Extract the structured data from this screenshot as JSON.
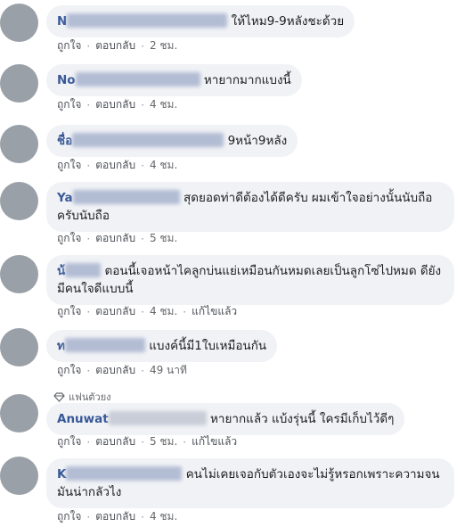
{
  "comments": [
    {
      "name": "N",
      "text": "ให้ไหม9-9หลังชะด้วย",
      "time": "2 ชม.",
      "edited": ""
    },
    {
      "name": "No",
      "text": "หายากมากแบงนี้",
      "time": "4 ชม.",
      "edited": ""
    },
    {
      "name": "ชื่อ",
      "text": "9หน้า9หลัง",
      "time": "4 ชม.",
      "edited": ""
    },
    {
      "name": "Ya",
      "text": "สุดยอดท่าดีต้องได้ดีครับ ผมเข้าใจอย่างนั้นนับถือครับนับถือ",
      "time": "5 ชม.",
      "edited": ""
    },
    {
      "name": "น้",
      "text": "ตอนนี้เจอหน้าไคลูกบ่นแย่เหมือนกันหมดเลยเป็นลูกโซ่ไปหมด ดียังมีคนใจดีแบบนี้",
      "time": "4 ชม.",
      "edited": "แก้ไขแล้ว"
    },
    {
      "name": "ท",
      "text": "แบงค์นี้มี1ใบเหมือนกัน",
      "time": "49 นาที",
      "edited": ""
    },
    {
      "name": "Anuwat",
      "text": "หายากแล้ว แบ้งรุ่นนี้ ใครมีเก็บไว้ดีๆ",
      "time": "5 ชม.",
      "edited": "แก้ไขแล้ว",
      "badge": "แฟนตัวยง"
    },
    {
      "name": "K",
      "text": "คนไม่เคยเจอกับตัวเองจะไม่รู้หรอกเพราะความจนมันน่ากลัวไง",
      "time": "4 ชม.",
      "edited": ""
    }
  ],
  "actions": {
    "like": "ถูกใจ",
    "reply": "ตอบกลับ"
  },
  "colors": {
    "bubble": "#f0f2f5",
    "name": "#385898",
    "meta": "#65676b"
  }
}
